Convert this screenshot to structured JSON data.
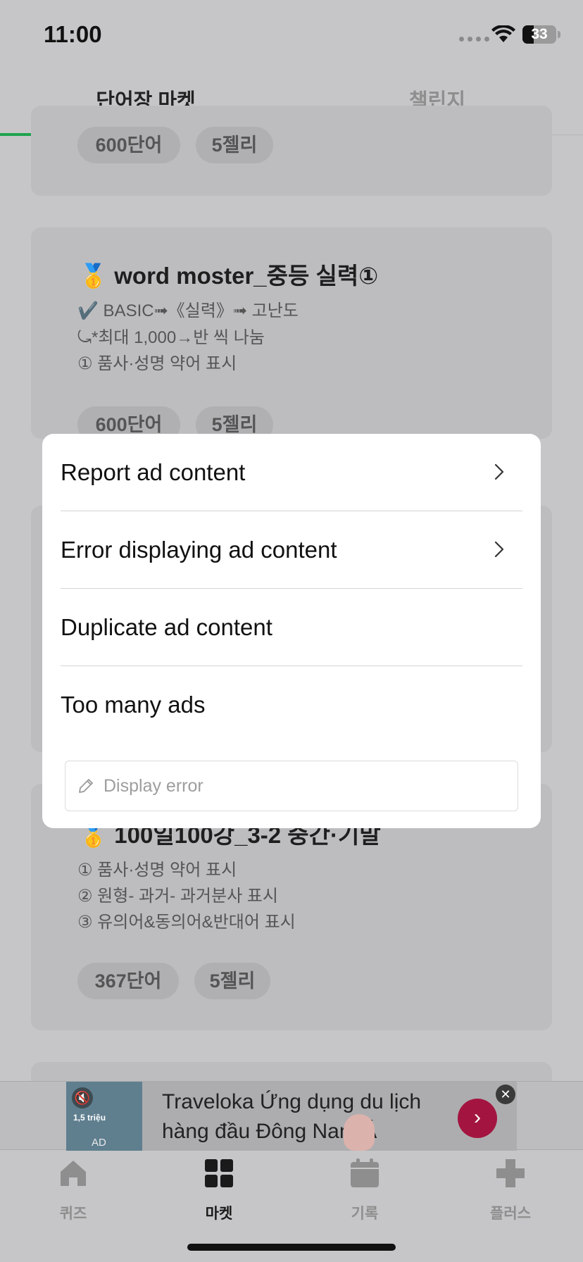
{
  "status_bar": {
    "time": "11:00",
    "battery": "33"
  },
  "tabs": [
    {
      "label": "단어장 마켓",
      "active": true
    },
    {
      "label": "챌린지",
      "active": false
    }
  ],
  "cards": [
    {
      "chips": [
        "600단어",
        "5젤리"
      ]
    },
    {
      "title": "🥇 word moster_중등 실력①",
      "lines": [
        "✔️ BASIC➟《실력》➟ 고난도",
        "⤿*최대 1,000→반 씩 나눔",
        "① 품사·성명 약어 표시"
      ],
      "chips": [
        "600단어",
        "5젤리"
      ]
    },
    {
      "title": "🥇 100일100강_3-2 중간·기말",
      "lines": [
        "① 품사·성명 약어 표시",
        "② 원형- 과거- 과거분사 표시",
        "③ 유의어&동의어&반대어 표시"
      ],
      "chips": [
        "367단어",
        "5젤리"
      ]
    }
  ],
  "ad_banner": {
    "text": "Traveloka Ứng dụng du lịch hàng đầu Đông Nam Á",
    "thumb_label": "AD",
    "thumb_price": "1,5 triệu",
    "go_icon": "chevron-right-icon",
    "close_icon": "close-icon"
  },
  "bottom_nav": [
    {
      "label": "퀴즈",
      "icon": "home-icon",
      "active": false
    },
    {
      "label": "마켓",
      "icon": "grid-icon",
      "active": true
    },
    {
      "label": "기록",
      "icon": "calendar-icon",
      "active": false
    },
    {
      "label": "플러스",
      "icon": "plus-icon",
      "active": false
    }
  ],
  "modal": {
    "items": [
      {
        "label": "Report ad content",
        "has_chevron": true
      },
      {
        "label": "Error displaying ad content",
        "has_chevron": true
      },
      {
        "label": "Duplicate ad content",
        "has_chevron": false
      },
      {
        "label": "Too many ads",
        "has_chevron": false
      }
    ],
    "input_placeholder": "Display error"
  },
  "colors": {
    "accent": "#1ea34e",
    "overlay": "#c6c6c8",
    "ad_button": "#a31540"
  }
}
